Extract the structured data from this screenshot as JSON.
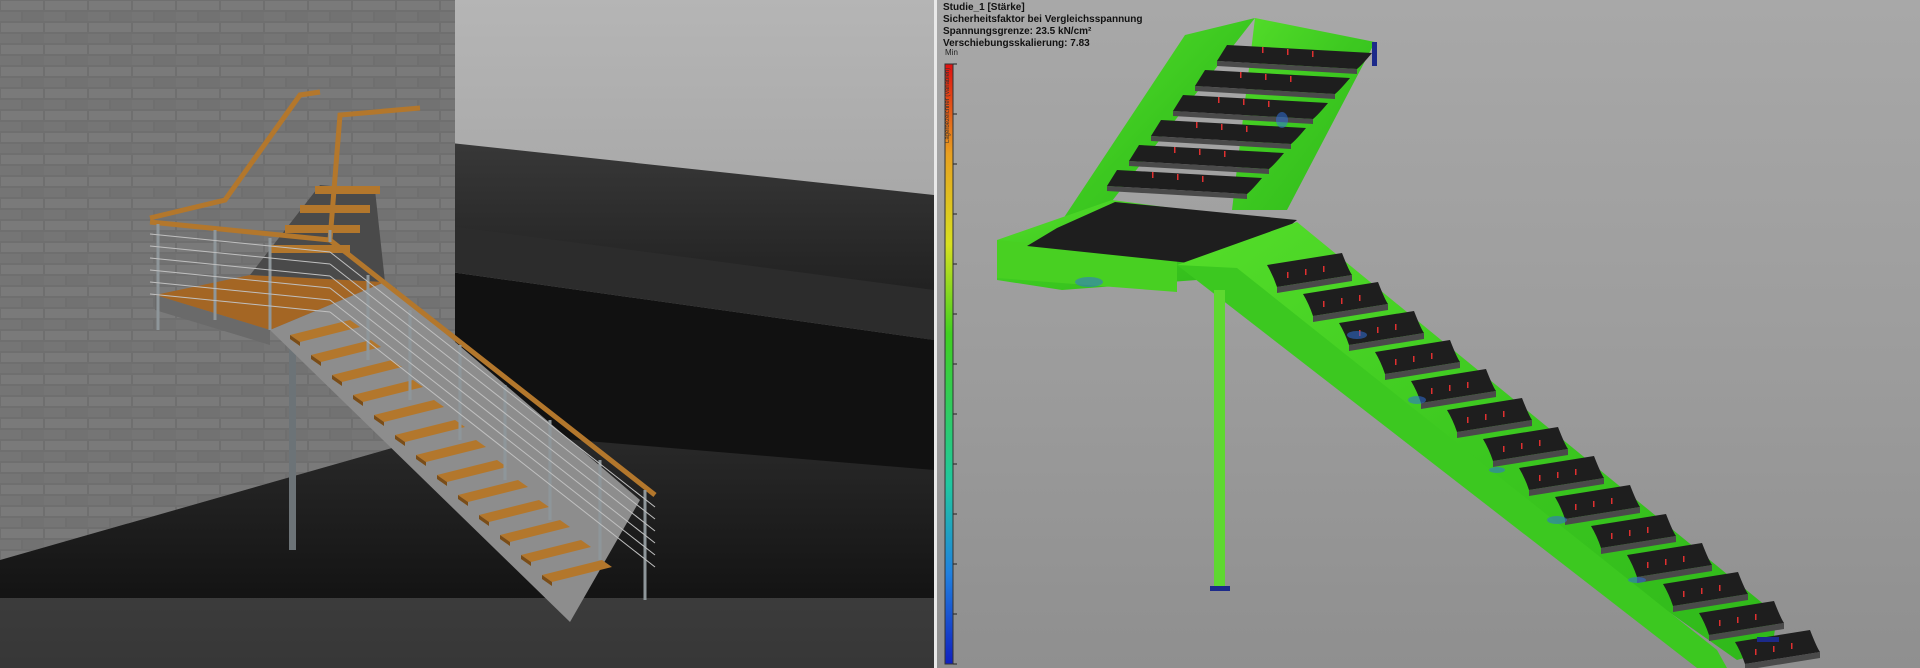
{
  "simulation": {
    "study": "Studie_1 [Stärke]",
    "factor": "Sicherheitsfaktor bei Vergleichsspannung",
    "limit": "Spannungsgrenze: 23.5 kN/cm²",
    "scale": "Verschiebungsskalierung: 7.83",
    "legend_min": "Min",
    "legend_axis": "Lagerbezeichner (Variablen)"
  },
  "colors": {
    "steel_green": "#3fd321",
    "stress_blue": "#2f6fd8",
    "tread_dark": "#1e1e1e",
    "wood": "#b3772c",
    "brick": "#6c6c6c",
    "load_marker": "#e03030"
  }
}
